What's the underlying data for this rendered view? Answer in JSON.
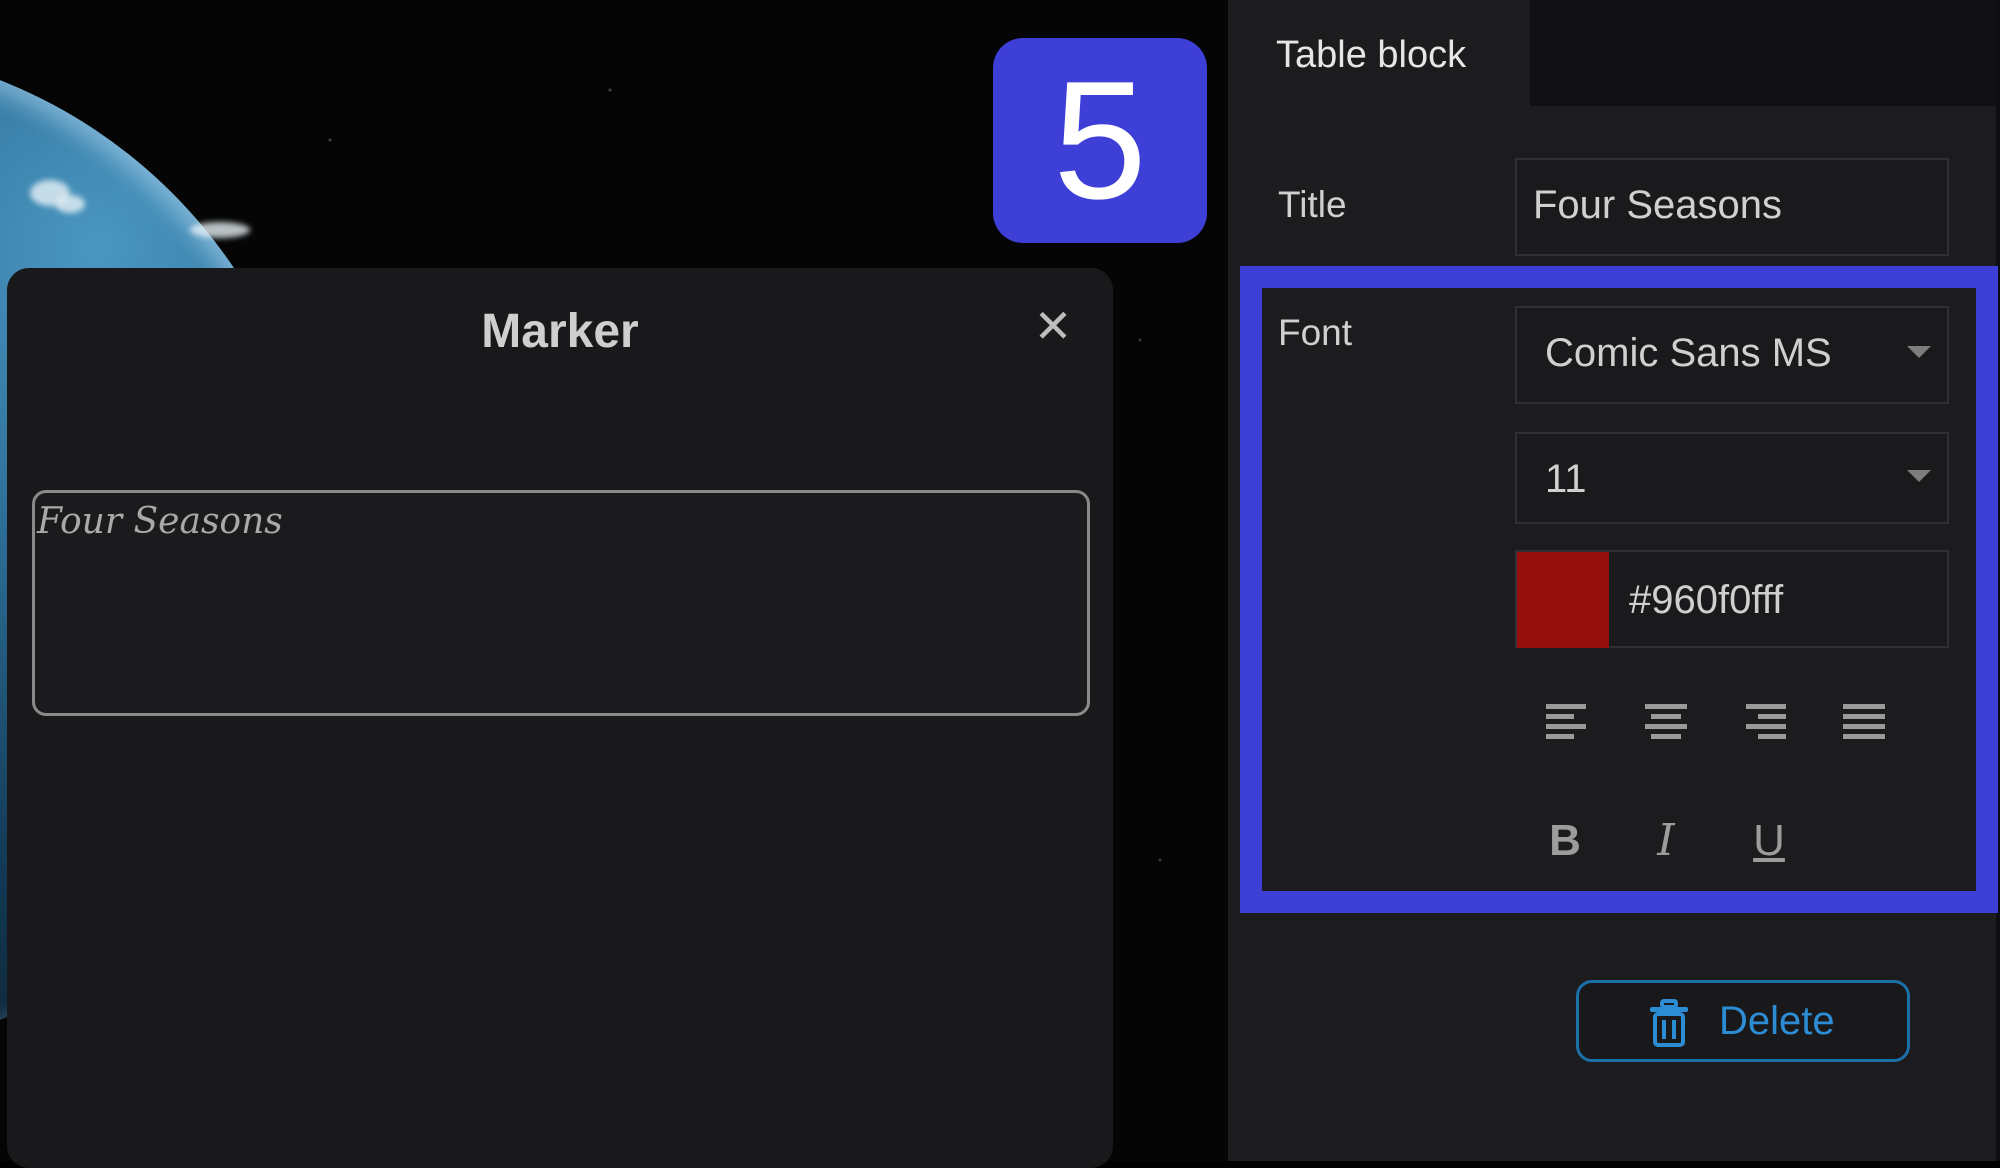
{
  "step": {
    "number": "5"
  },
  "marker_dialog": {
    "title": "Marker",
    "close_icon": "close-icon",
    "preview_text": "Four Seasons"
  },
  "panel": {
    "tab_label": "Table block",
    "title_label": "Title",
    "title_value": "Four Seasons",
    "font_label": "Font",
    "font_family": "Comic Sans MS",
    "font_size": "11",
    "font_color": "#960f0fff",
    "font_color_label": "#960f0fff",
    "align_icons": [
      "align-left-icon",
      "align-center-icon",
      "align-right-icon",
      "align-justify-icon"
    ],
    "format_buttons": [
      "B",
      "I",
      "U"
    ],
    "delete_label": "Delete",
    "delete_icon": "trash-icon"
  },
  "colors": {
    "highlight": "#3d3fd6",
    "delete_accent": "#2c8cd4",
    "panel_bg": "#1c1c1f",
    "dialog_bg": "#19191c"
  }
}
